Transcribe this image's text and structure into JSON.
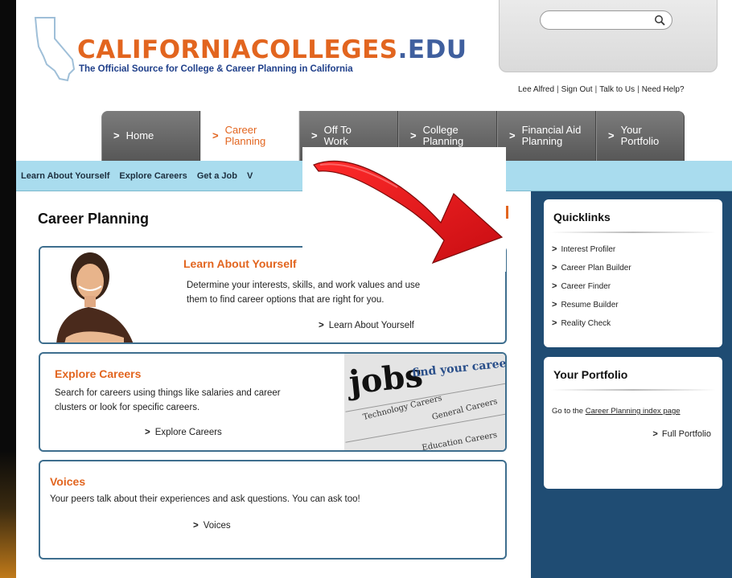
{
  "brand": {
    "title_main": "CALIFORNIACOLLEGES",
    "title_suffix": ".EDU",
    "tagline": "The Official Source for College & Career Planning in California"
  },
  "search": {
    "value": "",
    "placeholder": ""
  },
  "utility_links": [
    "Lee Alfred",
    "Sign Out",
    "Talk to Us",
    "Need Help?"
  ],
  "main_nav": [
    {
      "label_1": "Home",
      "label_2": ""
    },
    {
      "label_1": "Career",
      "label_2": "Planning"
    },
    {
      "label_1": "Off To",
      "label_2": "Work"
    },
    {
      "label_1": "College",
      "label_2": "Planning"
    },
    {
      "label_1": "Financial Aid",
      "label_2": "Planning"
    },
    {
      "label_1": "Your",
      "label_2": "Portfolio"
    }
  ],
  "sub_nav": [
    "Learn About Yourself",
    "Explore Careers",
    "Get a Job",
    "V"
  ],
  "page_title": "Career Planning",
  "cards": {
    "learn": {
      "title": "Learn About Yourself",
      "desc_1": "Determine your interests, skills, and work values and use",
      "desc_2": "them to find career options that are right for you.",
      "link": "Learn About Yourself"
    },
    "explore": {
      "title": "Explore Careers",
      "desc_1": "Search for careers using things like salaries and career",
      "desc_2": "clusters or look for specific careers.",
      "link": "Explore Careers",
      "image_headline": "jobs",
      "image_tagline": "find your career",
      "image_text_1": "Technology Careers",
      "image_text_2": "Education Careers",
      "image_text_3": "General Careers"
    },
    "voices": {
      "title": "Voices",
      "desc_1": "Your peers talk about their experiences and ask questions. You can ask too!",
      "link": "Voices"
    }
  },
  "quicklinks": {
    "heading": "Quicklinks",
    "items": [
      "Interest Profiler",
      "Career Plan Builder",
      "Career Finder",
      "Resume Builder",
      "Reality Check"
    ]
  },
  "portfolio": {
    "heading": "Your Portfolio",
    "text_prefix": "Go to the ",
    "text_link": "Career Planning index page",
    "link": "Full Portfolio"
  },
  "colors": {
    "brand_orange": "#e2651f",
    "nav_gray": "#666666",
    "subnav_blue": "#a9dcee",
    "sidebar_navy": "#1f4c73",
    "card_border": "#3e6e8e",
    "arrow_red": "#e8141a"
  },
  "icons": {
    "search": "search-icon",
    "chevron": "chevron-right-icon",
    "arrow": "red-curved-arrow-icon"
  }
}
